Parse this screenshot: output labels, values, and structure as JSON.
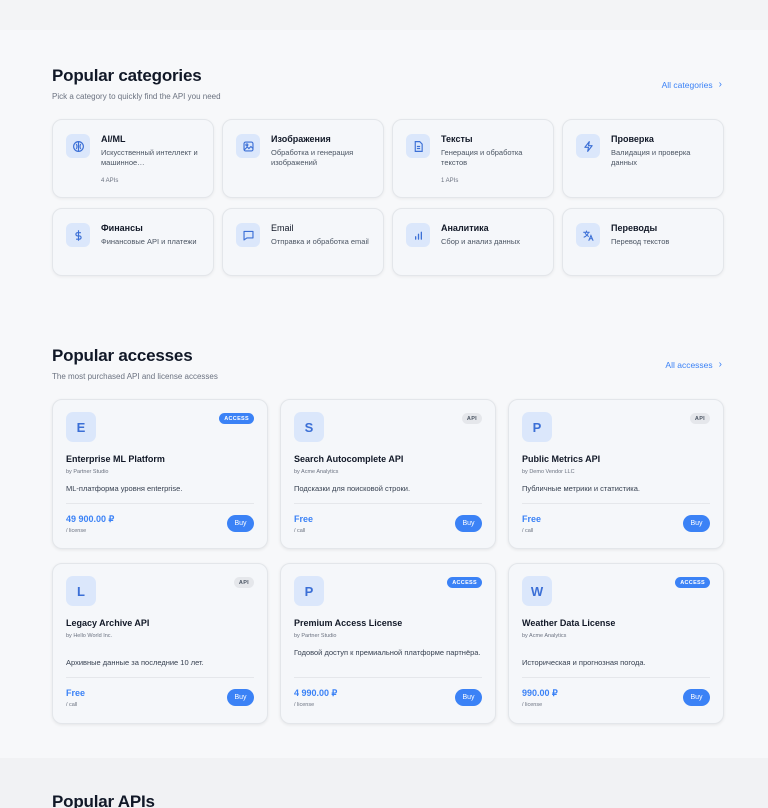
{
  "categories_section": {
    "title": "Popular categories",
    "subtitle": "Pick a category to quickly find the API you need",
    "see_all": "All categories",
    "items": [
      {
        "title": "AI/ML",
        "desc": "Искусственный интеллект и машинное…",
        "count": "4 APIs",
        "icon": "ai-brain-icon"
      },
      {
        "title": "Изображения",
        "desc": "Обработка и генерация изображений",
        "count": "",
        "icon": "image-icon"
      },
      {
        "title": "Тексты",
        "desc": "Генерация и обработка текстов",
        "count": "1 APIs",
        "icon": "document-icon"
      },
      {
        "title": "Проверка",
        "desc": "Валидация и проверка данных",
        "count": "",
        "icon": "lightning-icon"
      },
      {
        "title": "Финансы",
        "desc": "Финансовые API и платежи",
        "count": "",
        "icon": "dollar-icon"
      },
      {
        "title": "Email",
        "desc": "Отправка и обработка email",
        "count": "",
        "icon": "chat-icon"
      },
      {
        "title": "Аналитика",
        "desc": "Сбор и анализ данных",
        "count": "",
        "icon": "bar-chart-icon"
      },
      {
        "title": "Переводы",
        "desc": "Перевод текстов",
        "count": "",
        "icon": "translate-icon"
      }
    ]
  },
  "accesses_section": {
    "title": "Popular accesses",
    "subtitle": "The most purchased API and license accesses",
    "see_all": "All accesses",
    "buy_label": "Buy",
    "items": [
      {
        "letter": "E",
        "badge": "ACCESS",
        "title": "Enterprise ML Platform",
        "vendor": "by Partner Studio",
        "desc": "ML-платформа уровня enterprise.",
        "price": "49 900.00 ₽",
        "unit": "/ license"
      },
      {
        "letter": "S",
        "badge": "API",
        "title": "Search Autocomplete API",
        "vendor": "by Acme Analytics",
        "desc": "Подсказки для поисковой строки.",
        "price": "Free",
        "unit": "/ call"
      },
      {
        "letter": "P",
        "badge": "API",
        "title": "Public Metrics API",
        "vendor": "by Demo Vendor LLC",
        "desc": "Публичные метрики и статистика.",
        "price": "Free",
        "unit": "/ call"
      },
      {
        "letter": "L",
        "badge": "API",
        "title": "Legacy Archive API",
        "vendor": "by Hello World Inc.",
        "desc": "Архивные данные за последние 10 лет.",
        "price": "Free",
        "unit": "/ call"
      },
      {
        "letter": "P",
        "badge": "ACCESS",
        "title": "Premium Access License",
        "vendor": "by Partner Studio",
        "desc": "Годовой доступ к премиальной платформе партнёра.",
        "price": "4 990.00 ₽",
        "unit": "/ license"
      },
      {
        "letter": "W",
        "badge": "ACCESS",
        "title": "Weather Data License",
        "vendor": "by Acme Analytics",
        "desc": "Историческая и прогнозная погода.",
        "price": "990.00 ₽",
        "unit": "/ license"
      }
    ]
  },
  "apis_section": {
    "title": "Popular APIs"
  },
  "colors": {
    "accent": "#3b82f6",
    "icon_bg": "#dbe7fb",
    "card_bg": "#f5f7fa"
  }
}
